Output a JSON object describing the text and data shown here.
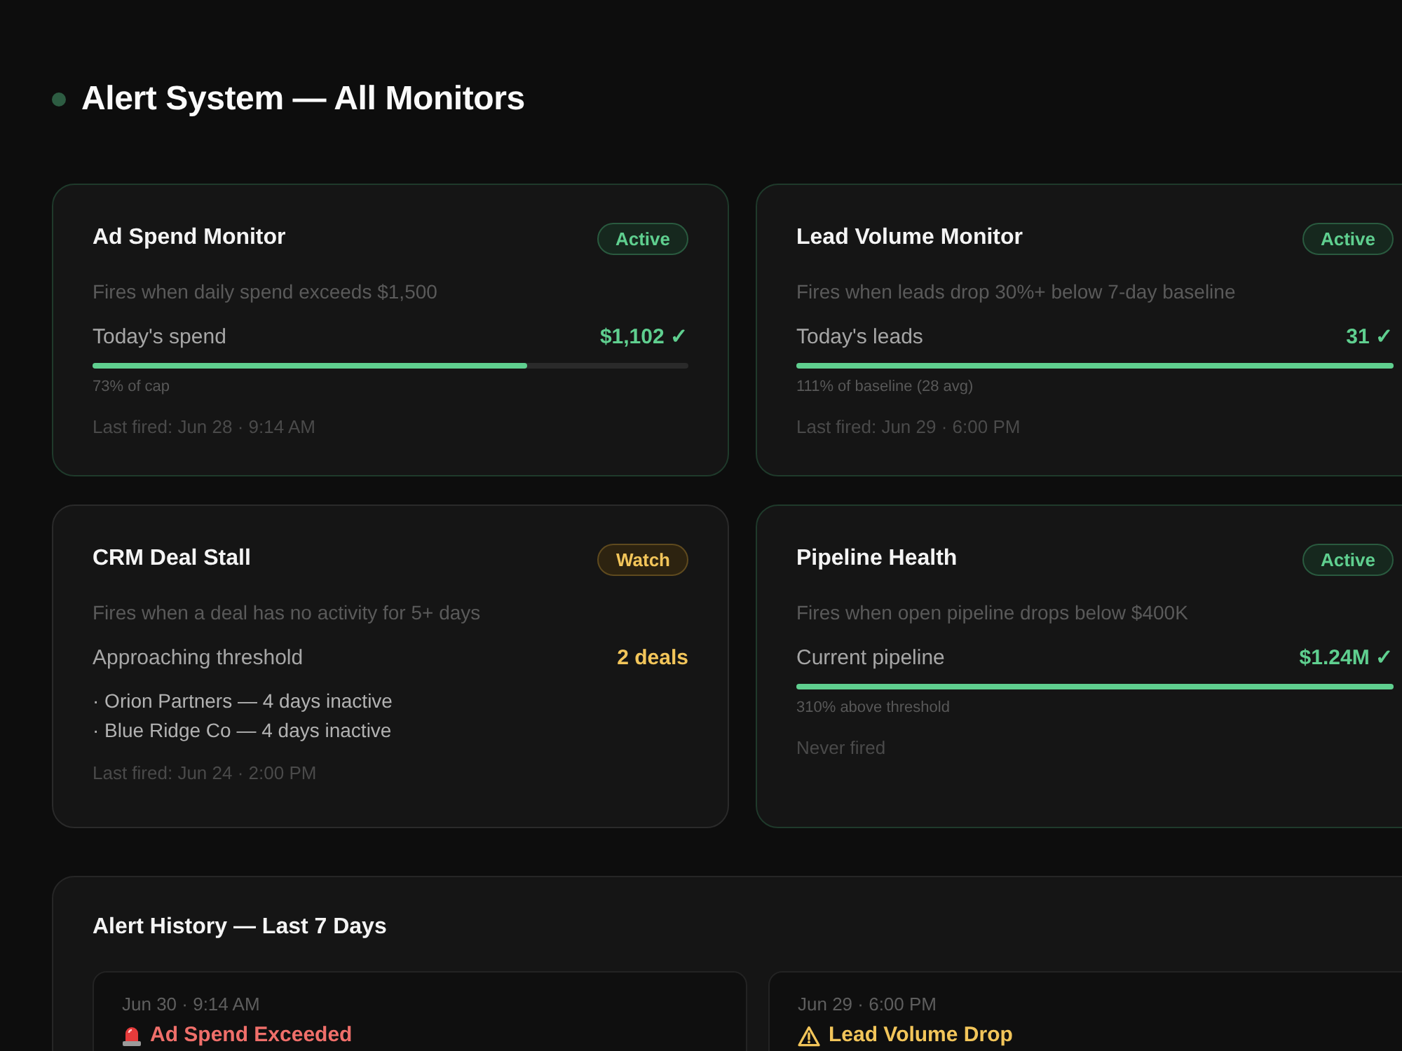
{
  "header": {
    "title": "Alert System — All Monitors"
  },
  "monitors": [
    {
      "kind": "progress",
      "title": "Ad Spend Monitor",
      "status": {
        "label": "Active",
        "kind": "active"
      },
      "description": "Fires when daily spend exceeds $1,500",
      "metric": {
        "label": "Today's spend",
        "value": "$1,102 ✓"
      },
      "level": 0.73,
      "note": "73% of cap",
      "last_fired": "Last fired: Jun 28 · 9:14 AM"
    },
    {
      "kind": "progress",
      "title": "Lead Volume Monitor",
      "status": {
        "label": "Active",
        "kind": "active"
      },
      "description": "Fires when leads drop 30%+ below 7-day baseline",
      "metric": {
        "label": "Today's leads",
        "value": "31 ✓"
      },
      "level": 1,
      "note": "111% of baseline (28 avg)",
      "last_fired": "Last fired: Jun 29 · 6:00 PM"
    },
    {
      "kind": "list",
      "title": "CRM Deal Stall",
      "status": {
        "label": "Watch",
        "kind": "watch"
      },
      "description": "Fires when a deal has no activity for 5+ days",
      "metric": {
        "label": "Approaching threshold",
        "value": "2 deals"
      },
      "items": [
        "· Orion Partners — 4 days inactive",
        "· Blue Ridge Co — 4 days inactive"
      ],
      "last_fired": "Last fired: Jun 24 · 2:00 PM"
    },
    {
      "kind": "progress",
      "title": "Pipeline Health",
      "status": {
        "label": "Active",
        "kind": "active"
      },
      "description": "Fires when open pipeline drops below $400K",
      "metric": {
        "label": "Current pipeline",
        "value": "$1.24M ✓"
      },
      "level": 1,
      "note": "310% above threshold",
      "last_fired": "Never fired"
    }
  ],
  "history": {
    "title": "Alert History — Last 7 Days",
    "entries": [
      {
        "kind": "critical",
        "time": "Jun 30 · 9:14 AM",
        "title": "Ad Spend Exceeded"
      },
      {
        "kind": "warning",
        "time": "Jun 29 · 6:00 PM",
        "title": "Lead Volume Drop"
      }
    ]
  }
}
